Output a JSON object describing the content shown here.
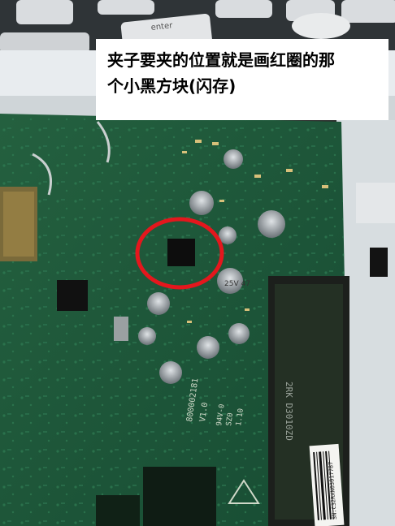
{
  "caption": {
    "line1": "夹子要夹的位置就是画红圈的那",
    "line2": "个小黑方块(闪存)"
  },
  "keyboard": {
    "key_label": "enter"
  },
  "board": {
    "silkscreen": [
      "800002181",
      "V1.0",
      "94V-0",
      "SZ0",
      "1.10"
    ],
    "capacitor_marking": "25V\n47",
    "ram_label": "2RK D3010ZD",
    "barcode_text": "SN:C32RXN03017787"
  },
  "colors": {
    "pcb": "#1f5a3c",
    "highlight_circle": "#e4171d",
    "caption_bg": "#ffffff"
  }
}
